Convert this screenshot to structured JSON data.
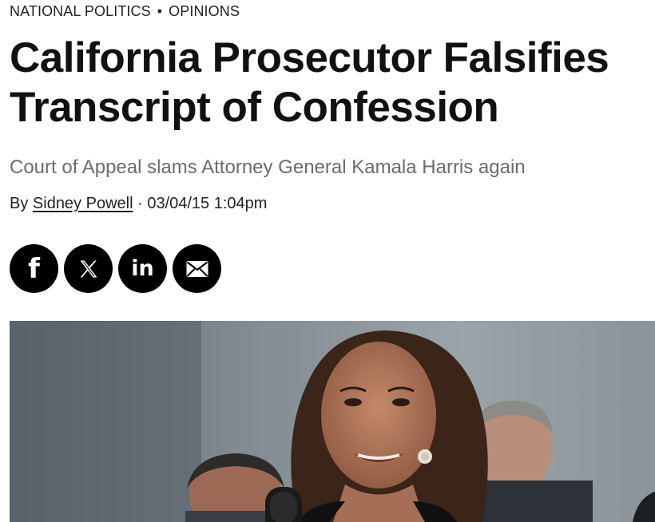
{
  "breadcrumb": {
    "items": [
      "NATIONAL POLITICS",
      "OPINIONS"
    ],
    "separator": "•"
  },
  "article": {
    "title": "California Prosecutor Falsifies Transcript of Confession",
    "subtitle": "Court of Appeal slams Attorney General Kamala Harris again",
    "byline_prefix": "By",
    "author": "Sidney Powell",
    "date_separator": "·",
    "timestamp": "03/04/15 1:04pm"
  },
  "share": {
    "buttons": [
      {
        "icon": "facebook-icon",
        "glyph": "f"
      },
      {
        "icon": "x-icon",
        "glyph": "𝕏"
      },
      {
        "icon": "linkedin-icon",
        "glyph": "in"
      },
      {
        "icon": "email-icon",
        "glyph": ""
      }
    ],
    "button_color": "#000000",
    "glyph_color": "#ffffff"
  },
  "hero_image": {
    "subject": "photo"
  }
}
